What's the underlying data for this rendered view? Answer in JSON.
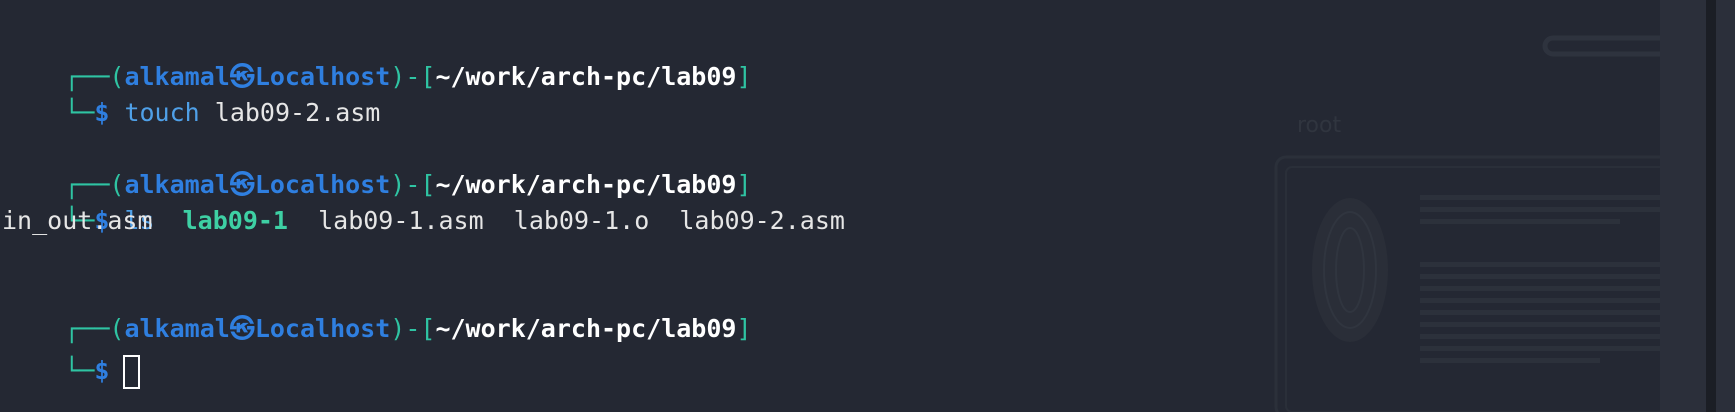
{
  "terminal": {
    "prompts": [
      {
        "user": "alkamal",
        "at_glyph": "㉿",
        "host": "Localhost",
        "path": "~/work/arch-pc/lab09",
        "dollar": "$",
        "command": "touch",
        "args": "lab09-2.asm"
      },
      {
        "user": "alkamal",
        "at_glyph": "㉿",
        "host": "Localhost",
        "path": "~/work/arch-pc/lab09",
        "dollar": "$",
        "command": "ls",
        "args": ""
      },
      {
        "user": "alkamal",
        "at_glyph": "㉿",
        "host": "Localhost",
        "path": "~/work/arch-pc/lab09",
        "dollar": "$",
        "command": "",
        "args": ""
      }
    ],
    "ls_output": [
      {
        "name": "in_out.asm",
        "type": "file"
      },
      {
        "name": "lab09-1",
        "type": "executable"
      },
      {
        "name": "lab09-1.asm",
        "type": "file"
      },
      {
        "name": "lab09-1.o",
        "type": "file"
      },
      {
        "name": "lab09-2.asm",
        "type": "file"
      }
    ],
    "wallpaper_text": "root"
  },
  "colors": {
    "background": "#242833",
    "prompt_box": "#2fc4a3",
    "prompt_user": "#2f7fe0",
    "path": "#ffffff",
    "executable": "#3ed0a4"
  }
}
